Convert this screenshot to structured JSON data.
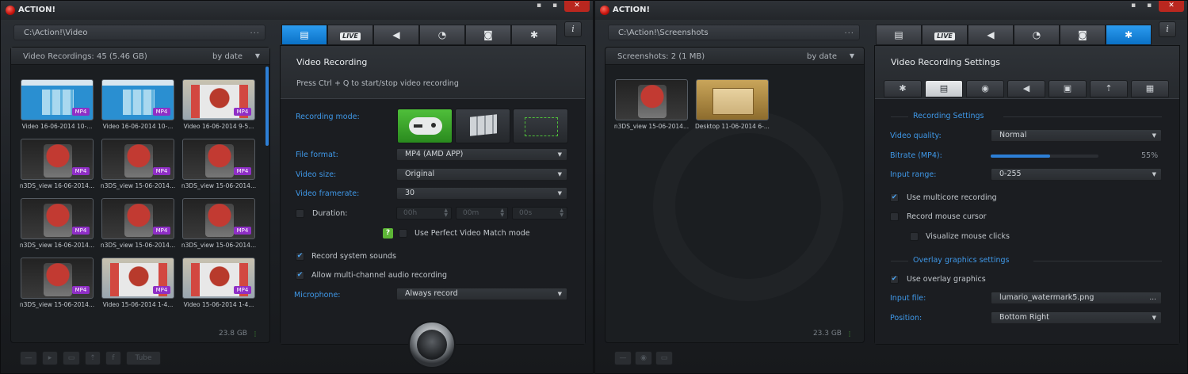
{
  "left": {
    "app_title": "ACTION!",
    "path": "C:\\Action!\\Video",
    "path_browse": "...",
    "list_title": "Video Recordings: 45 (5.46 GB)",
    "sort_label": "by date",
    "free_space": "23.8 GB",
    "thumbnails": [
      {
        "label": "Video 16-06-2014 10-...",
        "kind": "blue",
        "badge": "MP4"
      },
      {
        "label": "Video 16-06-2014 10-...",
        "kind": "blue",
        "badge": "MP4"
      },
      {
        "label": "Video 16-06-2014 9-5...",
        "kind": "desk",
        "badge": "MP4"
      },
      {
        "label": "n3DS_view 16-06-2014...",
        "kind": "game",
        "badge": "MP4"
      },
      {
        "label": "n3DS_view 15-06-2014...",
        "kind": "game",
        "badge": "MP4"
      },
      {
        "label": "n3DS_view 15-06-2014...",
        "kind": "game",
        "badge": "MP4"
      },
      {
        "label": "n3DS_view 16-06-2014...",
        "kind": "game",
        "badge": "MP4"
      },
      {
        "label": "n3DS_view 15-06-2014...",
        "kind": "game",
        "badge": "MP4"
      },
      {
        "label": "n3DS_view 15-06-2014...",
        "kind": "game",
        "badge": "MP4"
      },
      {
        "label": "n3DS_view 15-06-2014...",
        "kind": "game",
        "badge": "MP4"
      },
      {
        "label": "Video 15-06-2014 1-4...",
        "kind": "desk",
        "badge": "MP4"
      },
      {
        "label": "Video 15-06-2014 1-4...",
        "kind": "desk",
        "badge": "MP4"
      }
    ],
    "bottom_youtube": "Tube",
    "panel_title": "Video Recording",
    "panel_hint": "Press Ctrl + Q to start/stop video recording",
    "recording_mode_label": "Recording mode:",
    "file_format_label": "File format:",
    "file_format_value": "MP4 (AMD APP)",
    "video_size_label": "Video size:",
    "video_size_value": "Original",
    "framerate_label": "Video framerate:",
    "framerate_value": "30",
    "duration_label": "Duration:",
    "duration_h": "00h",
    "duration_m": "00m",
    "duration_s": "00s",
    "help_mark": "?",
    "perfect_match_label": "Use Perfect Video Match mode",
    "system_sounds_label": "Record system sounds",
    "multichannel_label": "Allow multi-channel audio recording",
    "microphone_label": "Microphone:",
    "microphone_value": "Always record",
    "info_glyph": "i"
  },
  "right": {
    "app_title": "ACTION!",
    "path": "C:\\Action!\\Screenshots",
    "path_browse": "...",
    "list_title": "Screenshots: 2 (1 MB)",
    "sort_label": "by date",
    "free_space": "23.3 GB",
    "thumbnails": [
      {
        "label": "n3DS_view 15-06-2014...",
        "kind": "game"
      },
      {
        "label": "Desktop 11-06-2014 6-...",
        "kind": "sshot"
      }
    ],
    "panel_title": "Video Recording Settings",
    "recording_settings_head": "Recording Settings",
    "video_quality_label": "Video quality:",
    "video_quality_value": "Normal",
    "bitrate_label": "Bitrate (MP4):",
    "bitrate_value": "55%",
    "bitrate_fraction": 0.55,
    "input_range_label": "Input range:",
    "input_range_value": "0-255",
    "multicore_label": "Use multicore recording",
    "mouse_cursor_label": "Record mouse cursor",
    "mouse_clicks_label": "Visualize mouse clicks",
    "overlay_head": "Overlay graphics settings",
    "use_overlay_label": "Use overlay graphics",
    "input_file_label": "Input file:",
    "input_file_value": "lumario_watermark5.png",
    "input_file_browse": "...",
    "position_label": "Position:",
    "position_value": "Bottom Right",
    "info_glyph": "i"
  },
  "window_controls": {
    "min": "▪",
    "max": "▪",
    "close": "✕"
  },
  "tabs": [
    "video-tab",
    "live-tab",
    "audio-tab",
    "benchmark-tab",
    "screenshot-tab",
    "settings-tab"
  ],
  "live_tab_label": "LIVE",
  "colors": {
    "accent": "#1a84e0",
    "mode_selected": "#3aa42a",
    "badge": "#8f2fc6",
    "close": "#b9271f"
  }
}
